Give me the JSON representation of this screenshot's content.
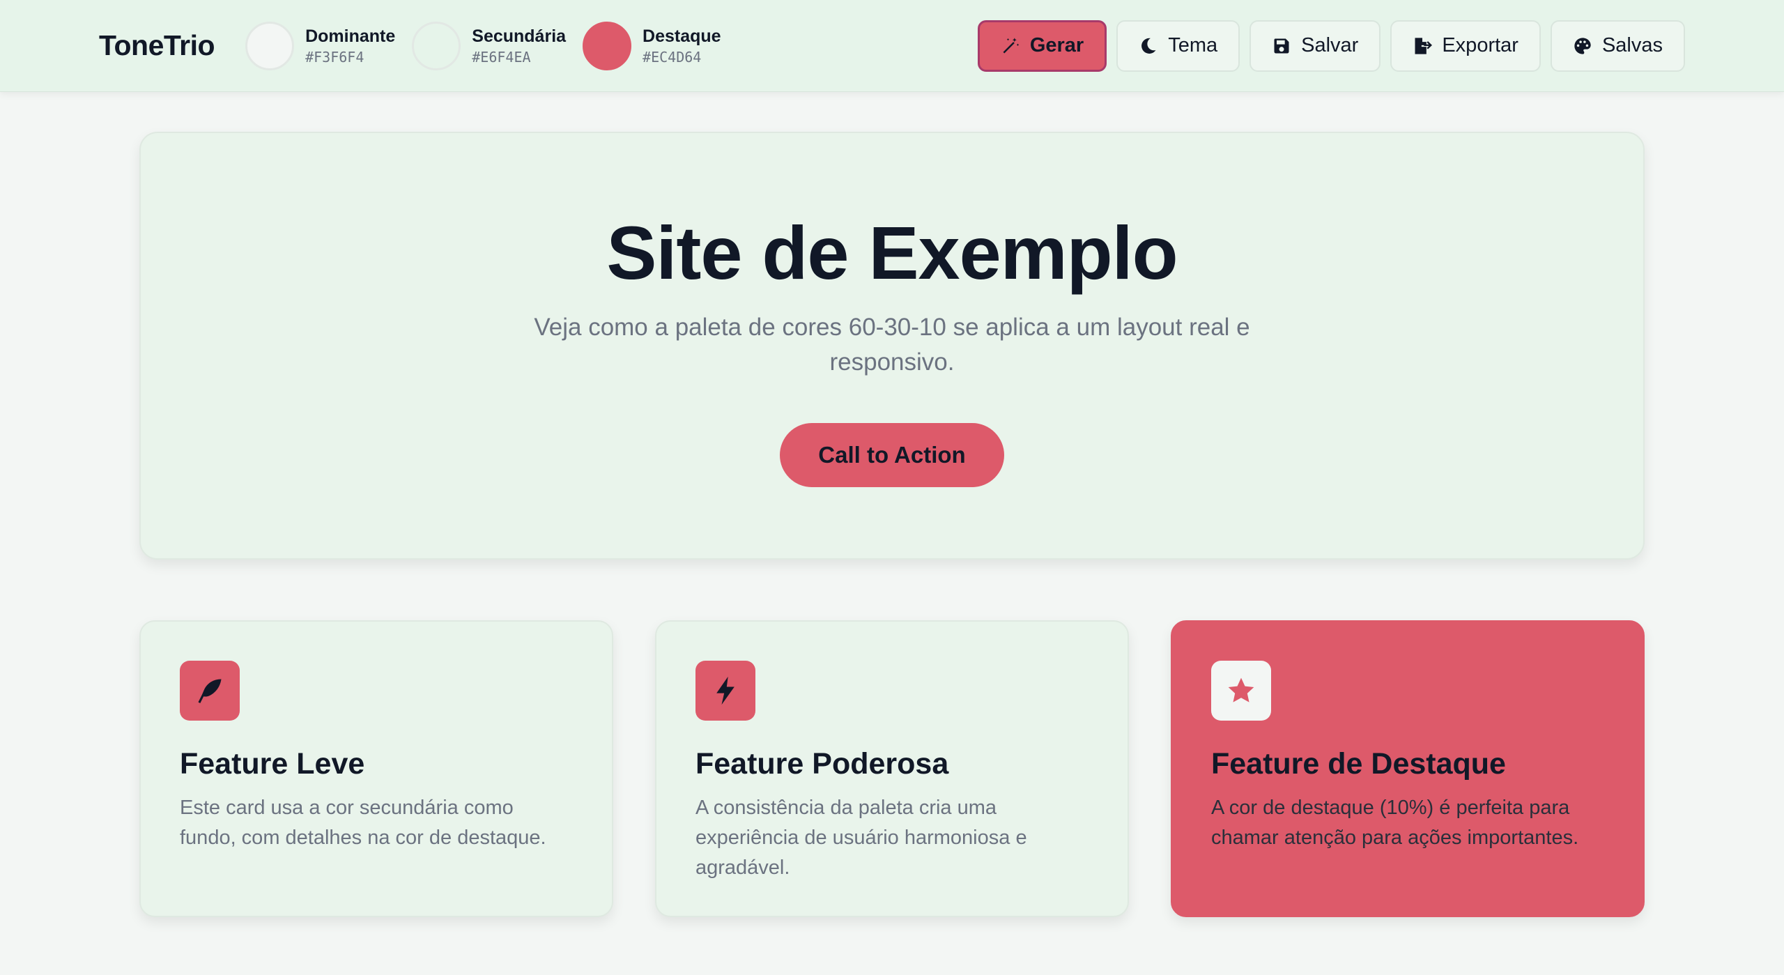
{
  "header": {
    "logo": "ToneTrio",
    "swatches": [
      {
        "name": "Dominante",
        "hex": "#F3F6F4"
      },
      {
        "name": "Secundária",
        "hex": "#E6F4EA"
      },
      {
        "name": "Destaque",
        "hex": "#EC4D64"
      }
    ],
    "actions": {
      "generate": {
        "label": "Gerar",
        "icon": "magic-wand-icon"
      },
      "theme": {
        "label": "Tema",
        "icon": "moon-icon"
      },
      "save": {
        "label": "Salvar",
        "icon": "floppy-disk-icon"
      },
      "export": {
        "label": "Exportar",
        "icon": "file-export-icon"
      },
      "saved": {
        "label": "Salvas",
        "icon": "palette-icon"
      }
    }
  },
  "hero": {
    "title": "Site de Exemplo",
    "subtitle": "Veja como a paleta de cores 60-30-10 se aplica a um layout real e responsivo.",
    "cta": "Call to Action"
  },
  "cards": [
    {
      "icon": "feather-icon",
      "title": "Feature Leve",
      "text": "Este card usa a cor secundária como fundo, com detalhes na cor de destaque."
    },
    {
      "icon": "bolt-icon",
      "title": "Feature Poderosa",
      "text": "A consistência da paleta cria uma experiência de usuário harmoniosa e agradável."
    },
    {
      "icon": "star-icon",
      "title": "Feature de Destaque",
      "text": "A cor de destaque (10%) é perfeita para chamar atenção para ações importantes."
    }
  ],
  "colors": {
    "dominant": "#F3F6F4",
    "secondary": "#E6F4EA",
    "accent": "#EC4D64",
    "text": "#111827",
    "muted": "#6B7280"
  }
}
